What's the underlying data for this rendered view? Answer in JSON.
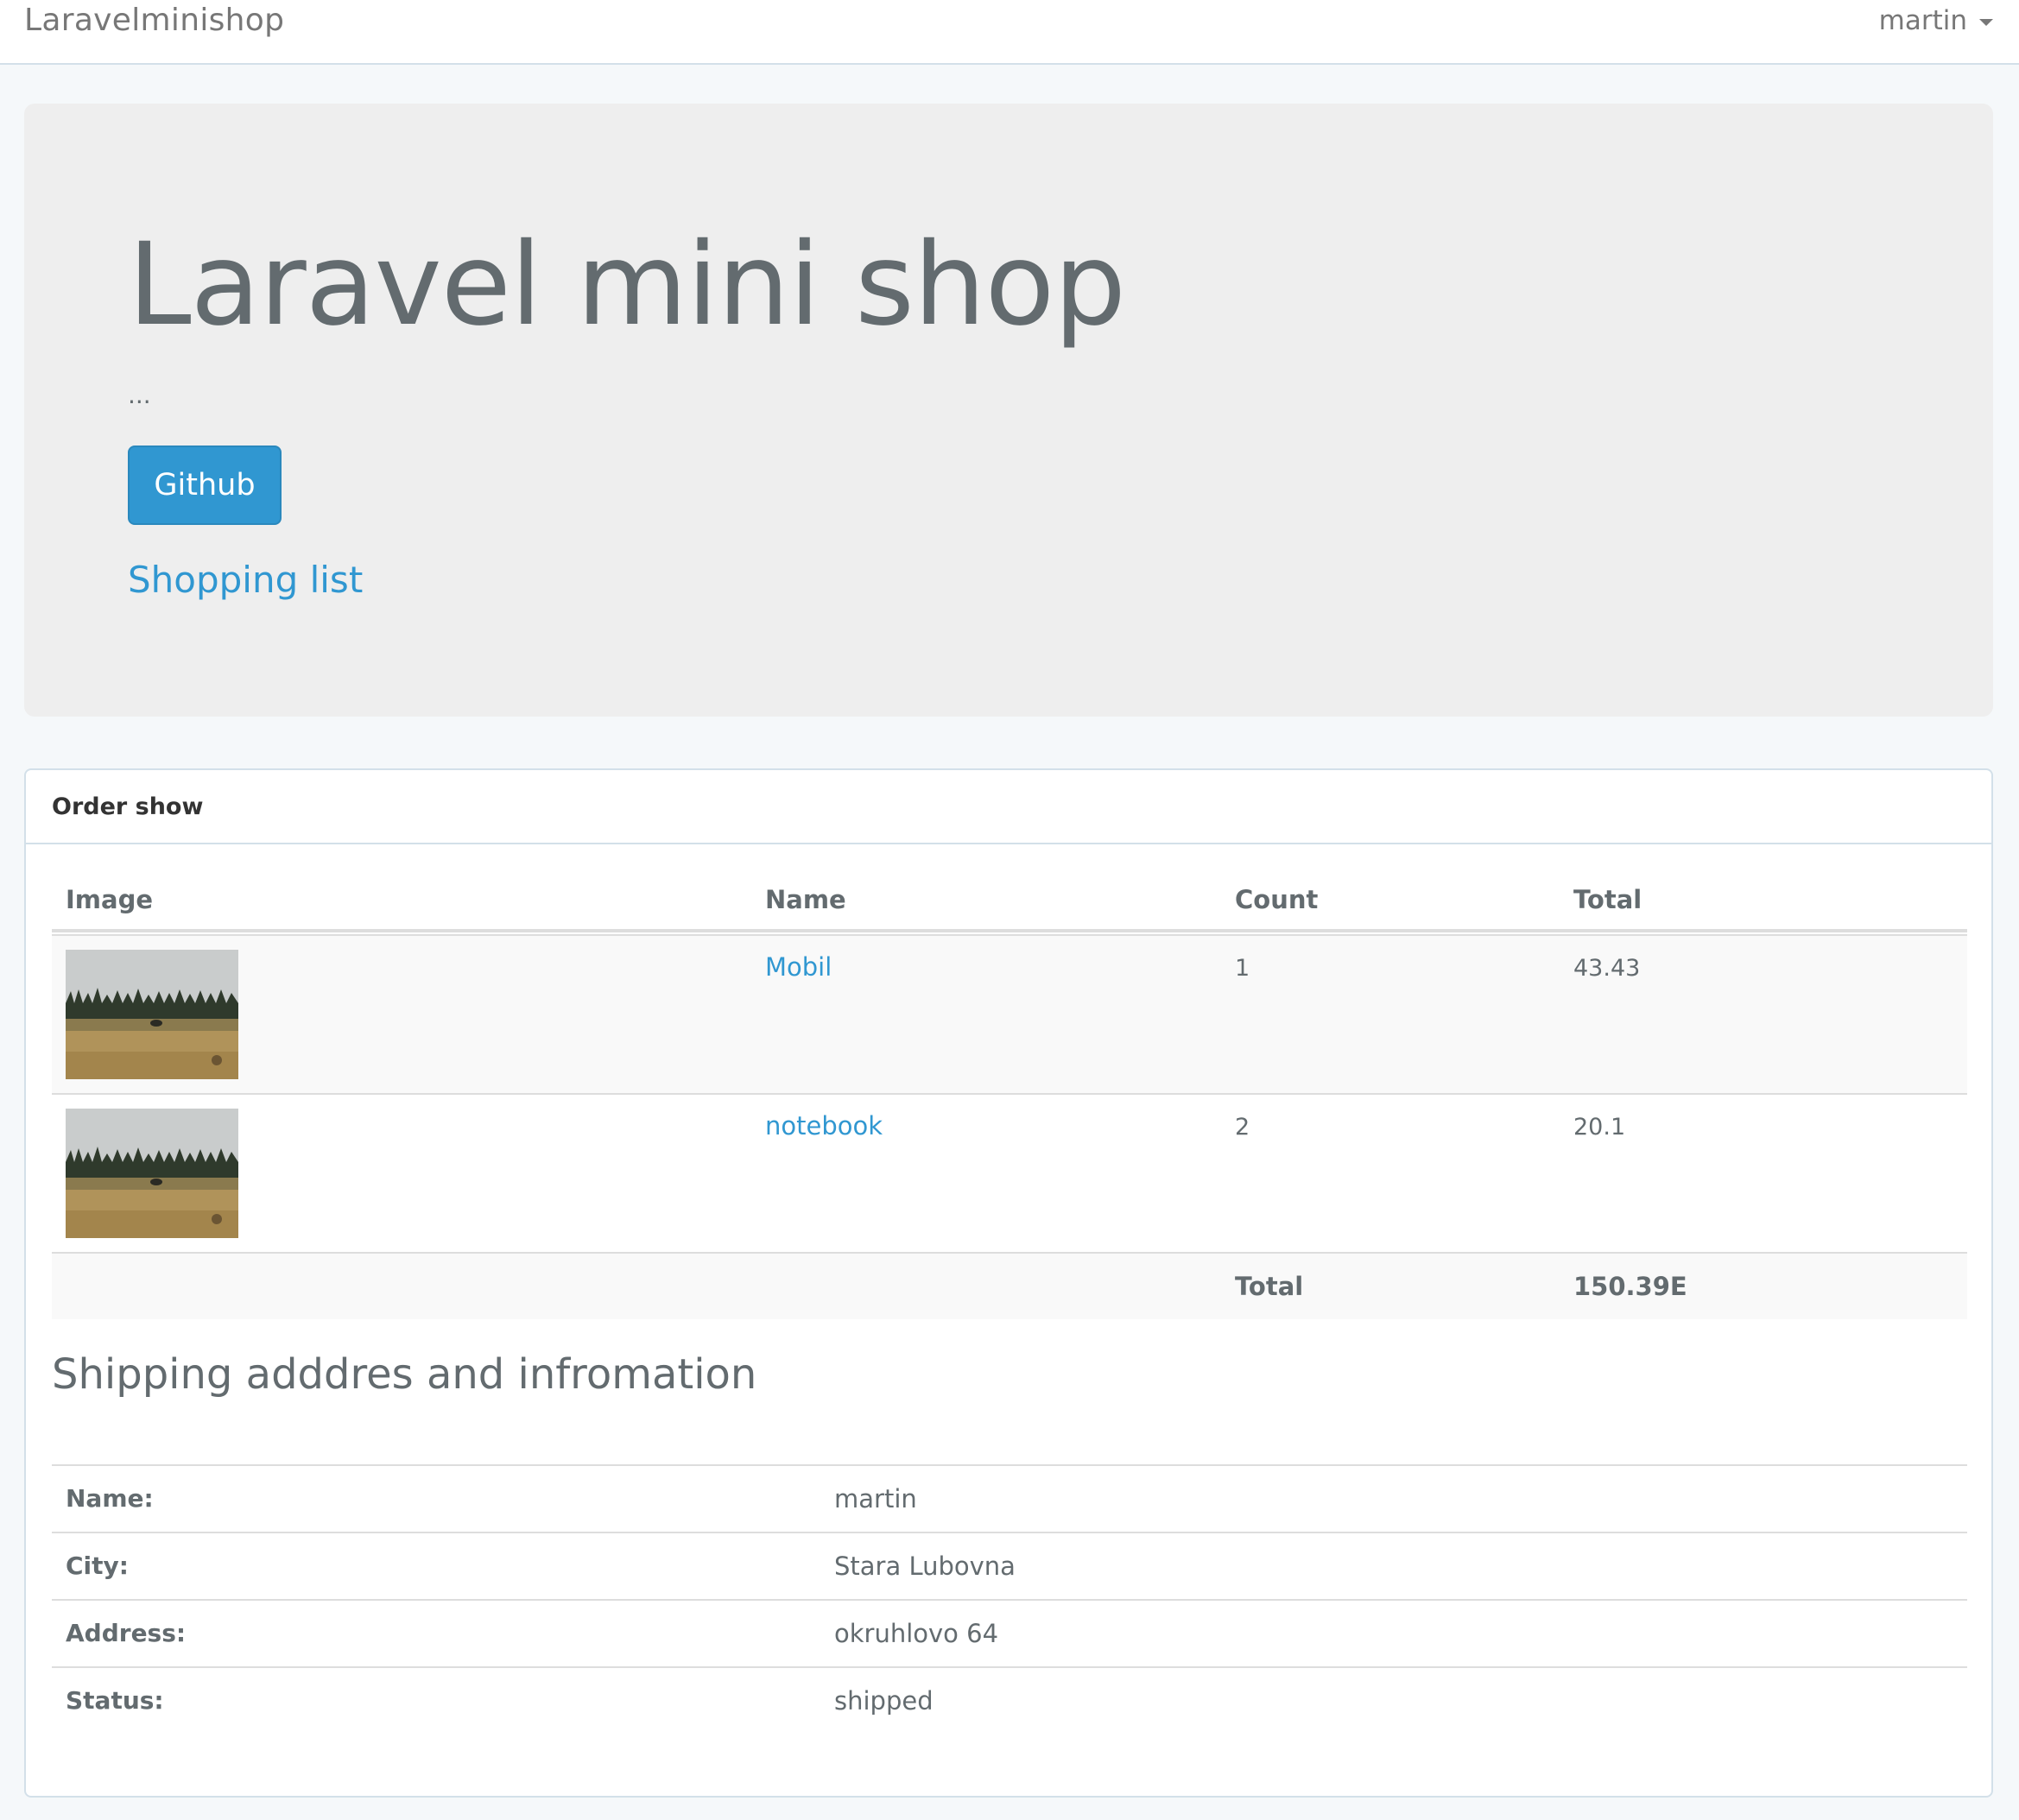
{
  "navbar": {
    "brand": "Laravelminishop",
    "user": "martin"
  },
  "jumbotron": {
    "title": "Laravel mini shop",
    "lead": "...",
    "github_button": "Github",
    "shopping_link": "Shopping list"
  },
  "panel": {
    "heading": "Order show",
    "table": {
      "headers": [
        "Image",
        "Name",
        "Count",
        "Total"
      ],
      "rows": [
        {
          "name": "Mobil",
          "count": "1",
          "total": "43.43"
        },
        {
          "name": "notebook",
          "count": "2",
          "total": "20.1"
        }
      ],
      "footer_label": "Total",
      "footer_value": "150.39E"
    },
    "shipping": {
      "title": "Shipping adddres and infromation",
      "rows": [
        {
          "label": "Name:",
          "value": "martin"
        },
        {
          "label": "City:",
          "value": "Stara Lubovna"
        },
        {
          "label": "Address:",
          "value": "okruhlovo 64"
        },
        {
          "label": "Status:",
          "value": "shipped"
        }
      ]
    }
  },
  "colors": {
    "accent": "#3097d1",
    "background": "#f5f8fa",
    "jumbotron": "#eeeeee",
    "text": "#636b6f"
  }
}
